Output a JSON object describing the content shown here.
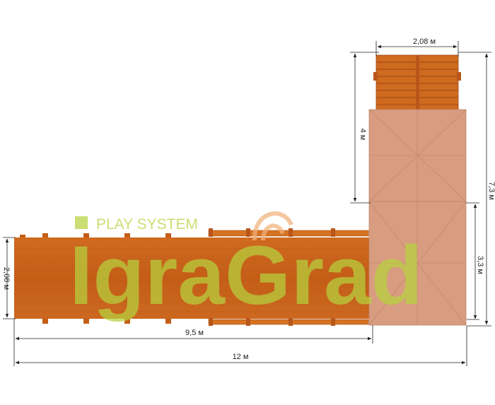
{
  "dimensions": {
    "top_width": "2,08 м",
    "top_left_height": "4 м",
    "right_total_height": "7,3 м",
    "right_lower_height": "3,3 м",
    "left_height": "2,08 м",
    "bottom_inner_width": "9,5 м",
    "bottom_total_width": "12 м"
  },
  "watermark": {
    "tagline": "PLAY SYSTEM",
    "brand": "IgraGrad",
    "color": "#b7d23e",
    "accent": "#f2b27a"
  },
  "colors": {
    "wood": "#c9631c",
    "wood_light": "#d97a2e",
    "roof": "#d79a7f",
    "line": "#222222"
  }
}
